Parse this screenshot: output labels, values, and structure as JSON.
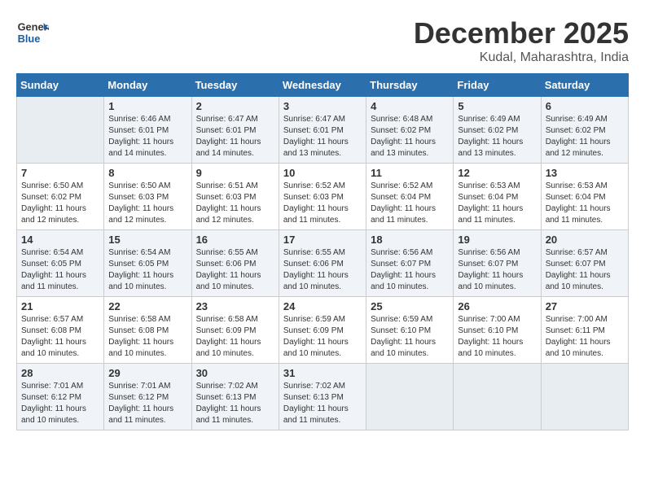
{
  "header": {
    "logo_general": "General",
    "logo_blue": "Blue",
    "month_title": "December 2025",
    "location": "Kudal, Maharashtra, India"
  },
  "days_of_week": [
    "Sunday",
    "Monday",
    "Tuesday",
    "Wednesday",
    "Thursday",
    "Friday",
    "Saturday"
  ],
  "weeks": [
    [
      {
        "day": "",
        "empty": true
      },
      {
        "day": "1",
        "sunrise": "6:46 AM",
        "sunset": "6:01 PM",
        "daylight": "11 hours and 14 minutes."
      },
      {
        "day": "2",
        "sunrise": "6:47 AM",
        "sunset": "6:01 PM",
        "daylight": "11 hours and 14 minutes."
      },
      {
        "day": "3",
        "sunrise": "6:47 AM",
        "sunset": "6:01 PM",
        "daylight": "11 hours and 13 minutes."
      },
      {
        "day": "4",
        "sunrise": "6:48 AM",
        "sunset": "6:02 PM",
        "daylight": "11 hours and 13 minutes."
      },
      {
        "day": "5",
        "sunrise": "6:49 AM",
        "sunset": "6:02 PM",
        "daylight": "11 hours and 13 minutes."
      },
      {
        "day": "6",
        "sunrise": "6:49 AM",
        "sunset": "6:02 PM",
        "daylight": "11 hours and 12 minutes."
      }
    ],
    [
      {
        "day": "7",
        "sunrise": "6:50 AM",
        "sunset": "6:02 PM",
        "daylight": "11 hours and 12 minutes."
      },
      {
        "day": "8",
        "sunrise": "6:50 AM",
        "sunset": "6:03 PM",
        "daylight": "11 hours and 12 minutes."
      },
      {
        "day": "9",
        "sunrise": "6:51 AM",
        "sunset": "6:03 PM",
        "daylight": "11 hours and 12 minutes."
      },
      {
        "day": "10",
        "sunrise": "6:52 AM",
        "sunset": "6:03 PM",
        "daylight": "11 hours and 11 minutes."
      },
      {
        "day": "11",
        "sunrise": "6:52 AM",
        "sunset": "6:04 PM",
        "daylight": "11 hours and 11 minutes."
      },
      {
        "day": "12",
        "sunrise": "6:53 AM",
        "sunset": "6:04 PM",
        "daylight": "11 hours and 11 minutes."
      },
      {
        "day": "13",
        "sunrise": "6:53 AM",
        "sunset": "6:04 PM",
        "daylight": "11 hours and 11 minutes."
      }
    ],
    [
      {
        "day": "14",
        "sunrise": "6:54 AM",
        "sunset": "6:05 PM",
        "daylight": "11 hours and 11 minutes."
      },
      {
        "day": "15",
        "sunrise": "6:54 AM",
        "sunset": "6:05 PM",
        "daylight": "11 hours and 10 minutes."
      },
      {
        "day": "16",
        "sunrise": "6:55 AM",
        "sunset": "6:06 PM",
        "daylight": "11 hours and 10 minutes."
      },
      {
        "day": "17",
        "sunrise": "6:55 AM",
        "sunset": "6:06 PM",
        "daylight": "11 hours and 10 minutes."
      },
      {
        "day": "18",
        "sunrise": "6:56 AM",
        "sunset": "6:07 PM",
        "daylight": "11 hours and 10 minutes."
      },
      {
        "day": "19",
        "sunrise": "6:56 AM",
        "sunset": "6:07 PM",
        "daylight": "11 hours and 10 minutes."
      },
      {
        "day": "20",
        "sunrise": "6:57 AM",
        "sunset": "6:07 PM",
        "daylight": "11 hours and 10 minutes."
      }
    ],
    [
      {
        "day": "21",
        "sunrise": "6:57 AM",
        "sunset": "6:08 PM",
        "daylight": "11 hours and 10 minutes."
      },
      {
        "day": "22",
        "sunrise": "6:58 AM",
        "sunset": "6:08 PM",
        "daylight": "11 hours and 10 minutes."
      },
      {
        "day": "23",
        "sunrise": "6:58 AM",
        "sunset": "6:09 PM",
        "daylight": "11 hours and 10 minutes."
      },
      {
        "day": "24",
        "sunrise": "6:59 AM",
        "sunset": "6:09 PM",
        "daylight": "11 hours and 10 minutes."
      },
      {
        "day": "25",
        "sunrise": "6:59 AM",
        "sunset": "6:10 PM",
        "daylight": "11 hours and 10 minutes."
      },
      {
        "day": "26",
        "sunrise": "7:00 AM",
        "sunset": "6:10 PM",
        "daylight": "11 hours and 10 minutes."
      },
      {
        "day": "27",
        "sunrise": "7:00 AM",
        "sunset": "6:11 PM",
        "daylight": "11 hours and 10 minutes."
      }
    ],
    [
      {
        "day": "28",
        "sunrise": "7:01 AM",
        "sunset": "6:12 PM",
        "daylight": "11 hours and 10 minutes."
      },
      {
        "day": "29",
        "sunrise": "7:01 AM",
        "sunset": "6:12 PM",
        "daylight": "11 hours and 11 minutes."
      },
      {
        "day": "30",
        "sunrise": "7:02 AM",
        "sunset": "6:13 PM",
        "daylight": "11 hours and 11 minutes."
      },
      {
        "day": "31",
        "sunrise": "7:02 AM",
        "sunset": "6:13 PM",
        "daylight": "11 hours and 11 minutes."
      },
      {
        "day": "",
        "empty": true
      },
      {
        "day": "",
        "empty": true
      },
      {
        "day": "",
        "empty": true
      }
    ]
  ],
  "labels": {
    "sunrise_prefix": "Sunrise: ",
    "sunset_prefix": "Sunset: ",
    "daylight_prefix": "Daylight: "
  }
}
